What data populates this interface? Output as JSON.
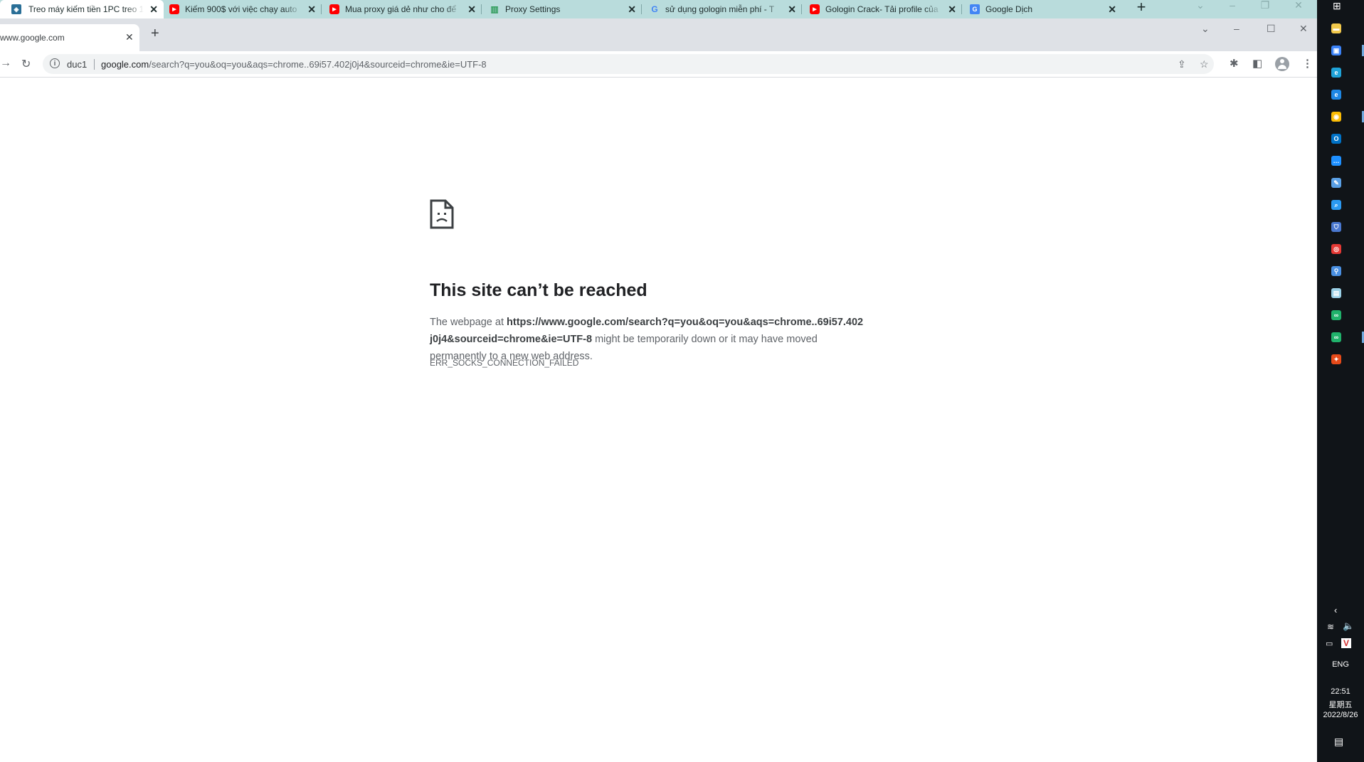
{
  "outer_tabs": [
    {
      "title": "Treo máy kiếm tiền 1PC treo 1",
      "favicon": "blockchain-icon",
      "favicon_color": "#2a6f97",
      "active": true
    },
    {
      "title": "Kiếm 900$ với việc chạy auto",
      "favicon": "youtube-icon",
      "favicon_color": "#ff0000",
      "active": false
    },
    {
      "title": "Mua proxy giá dẻ như cho để",
      "favicon": "youtube-icon",
      "favicon_color": "#ff0000",
      "active": false
    },
    {
      "title": "Proxy Settings",
      "favicon": "proxy-icon",
      "favicon_color": "#2e9b5a",
      "active": false
    },
    {
      "title": "sử dụng gologin miễn phí - T",
      "favicon": "google-icon",
      "favicon_color": "#4285f4",
      "active": false
    },
    {
      "title": "Gologin Crack- Tải profile của",
      "favicon": "youtube-icon",
      "favicon_color": "#ff0000",
      "active": false
    },
    {
      "title": "Google Dịch",
      "favicon": "google-translate-icon",
      "favicon_color": "#4285f4",
      "active": false
    }
  ],
  "inner_tab": {
    "title": "www.google.com"
  },
  "omnibox": {
    "profile_chip": "duc1",
    "url_domain": "google.com",
    "url_path": "/search?q=you&oq=you&aqs=chrome..69i57.402j0j4&sourceid=chrome&ie=UTF-8"
  },
  "error": {
    "title": "This site can’t be reached",
    "desc_prefix": "The webpage at ",
    "desc_url": "https://www.google.com/search?q=you&oq=you&aqs=chrome..69i57.402j0j4&sourceid=chrome&ie=UTF-8",
    "desc_suffix": " might be temporarily down or it may have moved permanently to a new web address.",
    "code": "ERR_SOCKS_CONNECTION_FAILED"
  },
  "taskbar": {
    "apps": [
      {
        "icon": "file-explorer-icon",
        "color": "#f2c94c"
      },
      {
        "icon": "remote-desktop-icon",
        "color": "#3b82f6"
      },
      {
        "icon": "edge-icon",
        "color": "#1fa3d8"
      },
      {
        "icon": "ie-icon",
        "color": "#1e88e5"
      },
      {
        "icon": "chrome-icon",
        "color": "#fbbc05"
      },
      {
        "icon": "outlook-icon",
        "color": "#0072c6"
      },
      {
        "icon": "chat-icon",
        "color": "#1e90ff"
      },
      {
        "icon": "tool-icon",
        "color": "#5aa0e6"
      },
      {
        "icon": "search-app-icon",
        "color": "#2b9af3"
      },
      {
        "icon": "shield-icon",
        "color": "#4a78d0"
      },
      {
        "icon": "target-app-icon",
        "color": "#e53935"
      },
      {
        "icon": "magnifier-app-icon",
        "color": "#4a90e2"
      },
      {
        "icon": "notebook-icon",
        "color": "#9ad0e6"
      },
      {
        "icon": "gologin-icon",
        "color": "#20b26b"
      },
      {
        "icon": "gologin-icon",
        "color": "#20b26b"
      },
      {
        "icon": "paint-icon",
        "color": "#e64a19"
      }
    ],
    "language": "ENG",
    "time": "22:51",
    "weekday": "星期五",
    "date": "2022/8/26"
  }
}
